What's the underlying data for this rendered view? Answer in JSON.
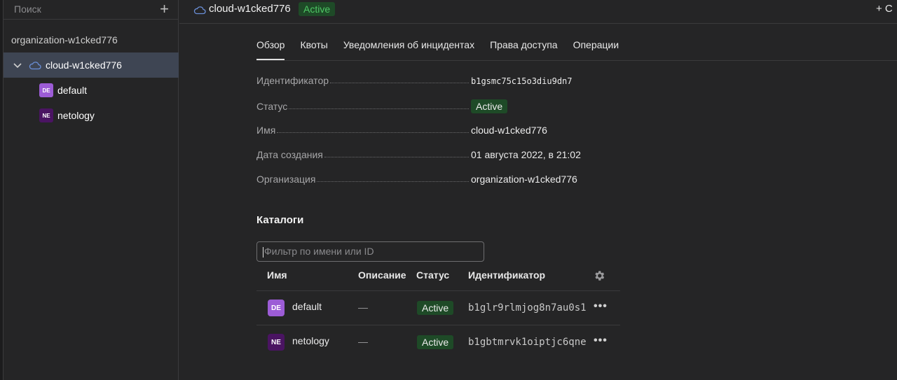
{
  "sidebar": {
    "search_placeholder": "Поиск",
    "add_label": "+",
    "organization": "organization-w1cked776",
    "cloud": "cloud-w1cked776",
    "folders": [
      {
        "badge": "DE",
        "name": "default"
      },
      {
        "badge": "NE",
        "name": "netology"
      }
    ]
  },
  "header": {
    "title": "cloud-w1cked776",
    "status": "Active",
    "create_label": "+ С"
  },
  "tabs": [
    "Обзор",
    "Квоты",
    "Уведомления об инцидентах",
    "Права доступа",
    "Операции"
  ],
  "details": [
    {
      "key": "Идентификатор",
      "value": "b1gsmc75c15o3diu9dn7"
    },
    {
      "key": "Статус",
      "value": "Active"
    },
    {
      "key": "Имя",
      "value": "cloud-w1cked776"
    },
    {
      "key": "Дата создания",
      "value": "01 августа 2022, в 21:02"
    },
    {
      "key": "Организация",
      "value": "organization-w1cked776"
    }
  ],
  "catalogs": {
    "title": "Каталоги",
    "filter_placeholder": "Фильтр по имени или ID",
    "columns": [
      "Имя",
      "Описание",
      "Статус",
      "Идентификатор"
    ],
    "rows": [
      {
        "badge": "DE",
        "name": "default",
        "description": "—",
        "status": "Active",
        "id": "b1glr9rlmjog8n7au0s1",
        "more": "•••"
      },
      {
        "badge": "NE",
        "name": "netology",
        "description": "—",
        "status": "Active",
        "id": "b1gbtmrvk1oiptjc6qne",
        "more": "•••"
      }
    ]
  },
  "colors": {
    "accent_active_bg": "#1e4a27",
    "accent_active_fg": "#4fc866",
    "badge_default": "#9c5cd6",
    "badge_netology": "#4a1462",
    "selected_row": "#3e4553"
  }
}
